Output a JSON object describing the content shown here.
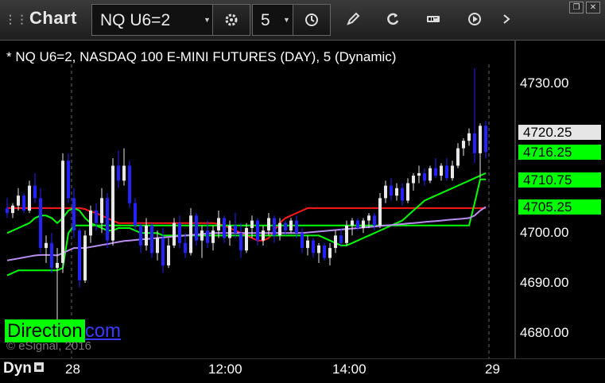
{
  "app": {
    "title": "Chart"
  },
  "toolbar": {
    "symbol_value": "NQ U6=2",
    "interval_value": "5",
    "icons": [
      "settings-gear-icon",
      "clock-icon",
      "pencil-icon",
      "refresh-icon",
      "get-icon",
      "play-icon",
      "more-icon"
    ]
  },
  "window_controls": [
    "restore-icon",
    "close-icon"
  ],
  "chart_header": "* NQ U6=2, NASDAQ 100 E-MINI FUTURES (DAY), 5 (Dynamic)",
  "y_axis": {
    "ticks": [
      "4730.00",
      "4700.00",
      "4690.00",
      "4680.00"
    ],
    "price_boxes": [
      {
        "label": "4720.25",
        "color": "#e6e6e6"
      },
      {
        "label": "4716.25",
        "color": "#00ff00"
      },
      {
        "label": "4710.75",
        "color": "#00ff00"
      },
      {
        "label": "4705.25",
        "color": "#00ff00"
      }
    ]
  },
  "x_axis": {
    "ticks": [
      "28",
      "12:00",
      "14:00",
      "29"
    ]
  },
  "status": {
    "mode": "Dyn"
  },
  "watermark": {
    "highlight": "Direction",
    "suffix": "com",
    "copyright": "© eSignal, 2016"
  },
  "colors": {
    "up": "#e8e8e8",
    "down": "#2222ff",
    "ma_red": "#ff1a1a",
    "ma_green": "#00ff00",
    "ma_purple": "#b98cf0",
    "background": "#000000"
  },
  "chart_data": {
    "type": "candlestick",
    "symbol": "NQ U6=2",
    "ylim": [
      4676,
      4734
    ],
    "candles": [
      [
        4705.0,
        4707.0,
        4703.0,
        4704.0
      ],
      [
        4704.0,
        4706.0,
        4703.0,
        4705.5
      ],
      [
        4705.5,
        4709.0,
        4704.5,
        4707.5
      ],
      [
        4707.5,
        4708.0,
        4704.0,
        4704.5
      ],
      [
        4704.5,
        4710.5,
        4704.0,
        4709.5
      ],
      [
        4709.5,
        4712.0,
        4706.0,
        4707.0
      ],
      [
        4707.0,
        4709.0,
        4696.0,
        4697.0
      ],
      [
        4697.0,
        4699.5,
        4694.0,
        4698.0
      ],
      [
        4698.0,
        4700.0,
        4692.0,
        4693.0
      ],
      [
        4693.0,
        4697.0,
        4682.0,
        4694.0
      ],
      [
        4694.0,
        4716.0,
        4692.0,
        4714.5
      ],
      [
        4714.5,
        4716.0,
        4706.0,
        4707.0
      ],
      [
        4707.0,
        4709.0,
        4699.0,
        4700.5
      ],
      [
        4700.5,
        4701.0,
        4689.0,
        4690.5
      ],
      [
        4690.5,
        4700.5,
        4690.0,
        4699.5
      ],
      [
        4699.5,
        4705.5,
        4698.0,
        4704.5
      ],
      [
        4704.5,
        4706.0,
        4700.5,
        4702.0
      ],
      [
        4702.0,
        4709.0,
        4700.0,
        4707.0
      ],
      [
        4707.0,
        4708.0,
        4697.0,
        4698.5
      ],
      [
        4698.5,
        4715.0,
        4697.5,
        4713.5
      ],
      [
        4713.5,
        4716.5,
        4709.0,
        4710.5
      ],
      [
        4710.5,
        4717.0,
        4709.5,
        4713.5
      ],
      [
        4713.5,
        4714.5,
        4705.0,
        4706.0
      ],
      [
        4706.0,
        4707.0,
        4700.5,
        4701.5
      ],
      [
        4701.5,
        4702.0,
        4696.0,
        4697.5
      ],
      [
        4697.5,
        4703.0,
        4696.5,
        4701.5
      ],
      [
        4701.5,
        4702.0,
        4695.0,
        4696.0
      ],
      [
        4696.0,
        4700.5,
        4694.5,
        4699.0
      ],
      [
        4699.0,
        4701.0,
        4692.0,
        4693.5
      ],
      [
        4693.5,
        4699.0,
        4693.0,
        4697.5
      ],
      [
        4697.5,
        4703.0,
        4697.0,
        4702.0
      ],
      [
        4702.0,
        4703.5,
        4697.0,
        4698.0
      ],
      [
        4698.0,
        4700.0,
        4695.0,
        4696.0
      ],
      [
        4696.0,
        4705.0,
        4695.5,
        4703.5
      ],
      [
        4703.5,
        4704.0,
        4697.5,
        4698.5
      ],
      [
        4698.5,
        4701.5,
        4695.0,
        4700.5
      ],
      [
        4700.5,
        4702.5,
        4697.0,
        4698.0
      ],
      [
        4698.0,
        4701.5,
        4696.5,
        4700.5
      ],
      [
        4700.5,
        4704.5,
        4699.0,
        4703.0
      ],
      [
        4703.0,
        4703.5,
        4698.0,
        4699.0
      ],
      [
        4699.0,
        4702.5,
        4697.5,
        4701.5
      ],
      [
        4701.5,
        4704.0,
        4699.0,
        4700.0
      ],
      [
        4700.0,
        4702.0,
        4695.0,
        4696.5
      ],
      [
        4696.5,
        4702.0,
        4696.0,
        4701.0
      ],
      [
        4701.0,
        4703.5,
        4699.0,
        4702.5
      ],
      [
        4702.5,
        4703.0,
        4697.5,
        4698.5
      ],
      [
        4698.5,
        4701.5,
        4697.5,
        4700.5
      ],
      [
        4700.5,
        4704.0,
        4699.5,
        4703.0
      ],
      [
        4703.0,
        4703.5,
        4698.0,
        4699.5
      ],
      [
        4699.5,
        4703.0,
        4698.5,
        4702.0
      ],
      [
        4702.0,
        4702.5,
        4699.5,
        4700.5
      ],
      [
        4700.5,
        4703.0,
        4700.0,
        4702.5
      ],
      [
        4702.5,
        4703.5,
        4699.0,
        4700.0
      ],
      [
        4700.0,
        4701.0,
        4696.0,
        4697.0
      ],
      [
        4697.0,
        4699.5,
        4695.5,
        4698.5
      ],
      [
        4698.5,
        4699.0,
        4695.0,
        4696.0
      ],
      [
        4696.0,
        4698.0,
        4694.0,
        4697.5
      ],
      [
        4697.5,
        4698.0,
        4694.5,
        4695.0
      ],
      [
        4695.0,
        4698.0,
        4693.5,
        4697.0
      ],
      [
        4697.0,
        4700.5,
        4696.0,
        4699.5
      ],
      [
        4699.5,
        4701.0,
        4697.5,
        4698.0
      ],
      [
        4698.0,
        4702.5,
        4697.5,
        4701.5
      ],
      [
        4701.5,
        4703.0,
        4699.5,
        4702.5
      ],
      [
        4702.5,
        4703.0,
        4700.5,
        4701.0
      ],
      [
        4701.0,
        4703.0,
        4700.0,
        4702.5
      ],
      [
        4702.5,
        4704.0,
        4701.0,
        4703.5
      ],
      [
        4703.5,
        4704.0,
        4700.5,
        4701.5
      ],
      [
        4701.5,
        4708.0,
        4701.0,
        4707.0
      ],
      [
        4707.0,
        4710.5,
        4706.0,
        4709.5
      ],
      [
        4709.5,
        4711.0,
        4706.5,
        4707.5
      ],
      [
        4707.5,
        4710.0,
        4706.5,
        4709.0
      ],
      [
        4709.0,
        4710.0,
        4705.5,
        4706.5
      ],
      [
        4706.5,
        4711.0,
        4706.0,
        4710.0
      ],
      [
        4710.0,
        4712.0,
        4708.5,
        4711.5
      ],
      [
        4711.5,
        4713.5,
        4710.0,
        4712.0
      ],
      [
        4712.0,
        4713.0,
        4709.5,
        4710.5
      ],
      [
        4710.5,
        4713.5,
        4710.0,
        4713.0
      ],
      [
        4713.0,
        4715.0,
        4711.0,
        4711.5
      ],
      [
        4711.5,
        4714.0,
        4710.5,
        4713.5
      ],
      [
        4713.5,
        4715.0,
        4710.5,
        4711.0
      ],
      [
        4711.0,
        4714.5,
        4710.5,
        4713.5
      ],
      [
        4713.5,
        4718.0,
        4713.0,
        4717.0
      ],
      [
        4717.0,
        4719.0,
        4715.5,
        4718.5
      ],
      [
        4718.5,
        4721.0,
        4717.5,
        4720.0
      ],
      [
        4720.0,
        4733.0,
        4714.0,
        4716.0
      ],
      [
        4716.0,
        4722.0,
        4711.0,
        4721.5
      ],
      [
        4721.5,
        4722.5,
        4715.0,
        4716.25
      ]
    ],
    "series": [
      {
        "name": "",
        "color": "#ff1a1a",
        "values": [
          4705.0,
          4705.0,
          4705.0,
          4705.0,
          4705.0,
          4705.0,
          4705.0,
          4705.0,
          4705.0,
          4705.0,
          4705.0,
          4705.0,
          4705.0,
          4705.0,
          4704.8,
          4704.3,
          4704.0,
          4703.5,
          4703.0,
          4702.5,
          4702.0,
          4702.0,
          4702.0,
          4702.0,
          4702.0,
          4702.0,
          4702.0,
          4702.0,
          4702.0,
          4702.0,
          4702.0,
          4702.0,
          4702.0,
          4702.0,
          4702.0,
          4702.0,
          4702.0,
          4702.0,
          4701.8,
          4701.5,
          4701.0,
          4700.5,
          4700.0,
          4699.5,
          4699.0,
          4698.5,
          4698.5,
          4699.0,
          4700.5,
          4702.0,
          4703.0,
          4703.5,
          4704.0,
          4704.5,
          4705.0,
          4705.0,
          4705.0,
          4705.0,
          4705.0,
          4705.0,
          4705.0,
          4705.0,
          4705.0,
          4705.0,
          4705.0,
          4705.0,
          4705.0,
          4705.0,
          4705.0,
          4705.0,
          4705.0,
          4705.0,
          4705.0,
          4705.0,
          4705.0,
          4705.0,
          4705.0,
          4705.0,
          4705.0,
          4705.0,
          4705.0,
          4705.0,
          4705.0,
          4705.0,
          4705.0,
          4705.0,
          4705.0
        ]
      },
      {
        "name": "",
        "color": "#00ff00",
        "values": [
          4700.0,
          4700.5,
          4701.0,
          4701.5,
          4702.0,
          4703.0,
          4703.5,
          4703.5,
          4703.0,
          4702.0,
          4703.0,
          4704.5,
          4705.0,
          4704.5,
          4703.0,
          4702.0,
          4701.5,
          4701.0,
          4700.5,
          4700.5,
          4701.0,
          4701.0,
          4701.0,
          4700.5,
          4700.0,
          4700.0,
          4700.0,
          4700.0,
          4699.5,
          4699.5,
          4699.5,
          4699.5,
          4699.5,
          4699.5,
          4699.5,
          4699.5,
          4699.5,
          4699.5,
          4699.5,
          4699.5,
          4699.5,
          4699.5,
          4699.5,
          4699.5,
          4699.5,
          4699.5,
          4699.5,
          4699.5,
          4699.5,
          4699.5,
          4699.5,
          4699.5,
          4699.5,
          4699.5,
          4699.5,
          4699.5,
          4699.5,
          4699.0,
          4698.5,
          4698.0,
          4697.5,
          4697.5,
          4698.0,
          4698.5,
          4699.0,
          4699.5,
          4700.0,
          4700.5,
          4701.0,
          4701.5,
          4702.0,
          4702.5,
          4703.5,
          4704.5,
          4705.5,
          4706.5,
          4707.0,
          4707.5,
          4708.0,
          4708.5,
          4709.0,
          4709.5,
          4710.0,
          4710.5,
          4711.0,
          4711.5,
          4712.0
        ]
      },
      {
        "name": "",
        "color": "#00ff00",
        "values": [
          4691.5,
          4692.0,
          4692.5,
          4692.5,
          4692.5,
          4692.5,
          4692.5,
          4692.5,
          4692.5,
          4692.5,
          4693.0,
          4700.0,
          4701.5,
          4701.5,
          4701.5,
          4701.5,
          4701.5,
          4701.5,
          4701.5,
          4701.5,
          4701.5,
          4701.5,
          4701.5,
          4701.5,
          4701.5,
          4701.5,
          4701.5,
          4701.5,
          4701.5,
          4701.5,
          4701.5,
          4701.5,
          4701.5,
          4701.5,
          4701.5,
          4701.5,
          4701.5,
          4701.5,
          4701.5,
          4701.5,
          4701.5,
          4701.5,
          4701.5,
          4701.5,
          4701.5,
          4701.5,
          4701.5,
          4701.5,
          4701.5,
          4701.5,
          4701.5,
          4701.5,
          4701.5,
          4701.5,
          4701.5,
          4701.5,
          4701.5,
          4701.5,
          4701.5,
          4701.5,
          4701.5,
          4701.5,
          4701.5,
          4701.5,
          4701.5,
          4701.5,
          4701.5,
          4701.5,
          4701.5,
          4701.5,
          4701.5,
          4701.5,
          4701.5,
          4701.5,
          4701.5,
          4701.5,
          4701.5,
          4701.5,
          4701.5,
          4701.5,
          4701.5,
          4701.5,
          4701.5,
          4701.5,
          4706.0,
          4710.75,
          4710.75
        ]
      },
      {
        "name": "",
        "color": "#b98cf0",
        "values": [
          4694.5,
          4694.7,
          4694.9,
          4695.1,
          4695.3,
          4695.5,
          4695.6,
          4695.6,
          4695.6,
          4695.5,
          4696.0,
          4696.5,
          4697.0,
          4697.0,
          4697.0,
          4697.2,
          4697.4,
          4697.6,
          4697.8,
          4698.0,
          4698.2,
          4698.4,
          4698.5,
          4698.6,
          4698.7,
          4698.8,
          4698.9,
          4699.0,
          4699.1,
          4699.2,
          4699.3,
          4699.4,
          4699.5,
          4699.6,
          4699.7,
          4699.8,
          4699.9,
          4700.0,
          4700.0,
          4700.0,
          4700.0,
          4700.0,
          4700.0,
          4700.0,
          4700.0,
          4700.0,
          4700.0,
          4700.0,
          4700.0,
          4700.0,
          4700.0,
          4700.0,
          4700.0,
          4700.0,
          4700.1,
          4700.2,
          4700.3,
          4700.4,
          4700.5,
          4700.6,
          4700.7,
          4700.8,
          4700.9,
          4701.0,
          4701.1,
          4701.2,
          4701.3,
          4701.4,
          4701.5,
          4701.6,
          4701.7,
          4701.8,
          4701.9,
          4702.0,
          4702.1,
          4702.2,
          4702.3,
          4702.4,
          4702.5,
          4702.6,
          4702.7,
          4702.8,
          4702.9,
          4703.0,
          4703.5,
          4704.5,
          4705.25
        ]
      }
    ],
    "xlabel": "",
    "ylabel": "",
    "x_tick_labels": [
      "28",
      "12:00",
      "14:00",
      "29"
    ],
    "y_tick_labels": [
      "4730.00",
      "4700.00",
      "4690.00",
      "4680.00"
    ],
    "grid": false
  }
}
